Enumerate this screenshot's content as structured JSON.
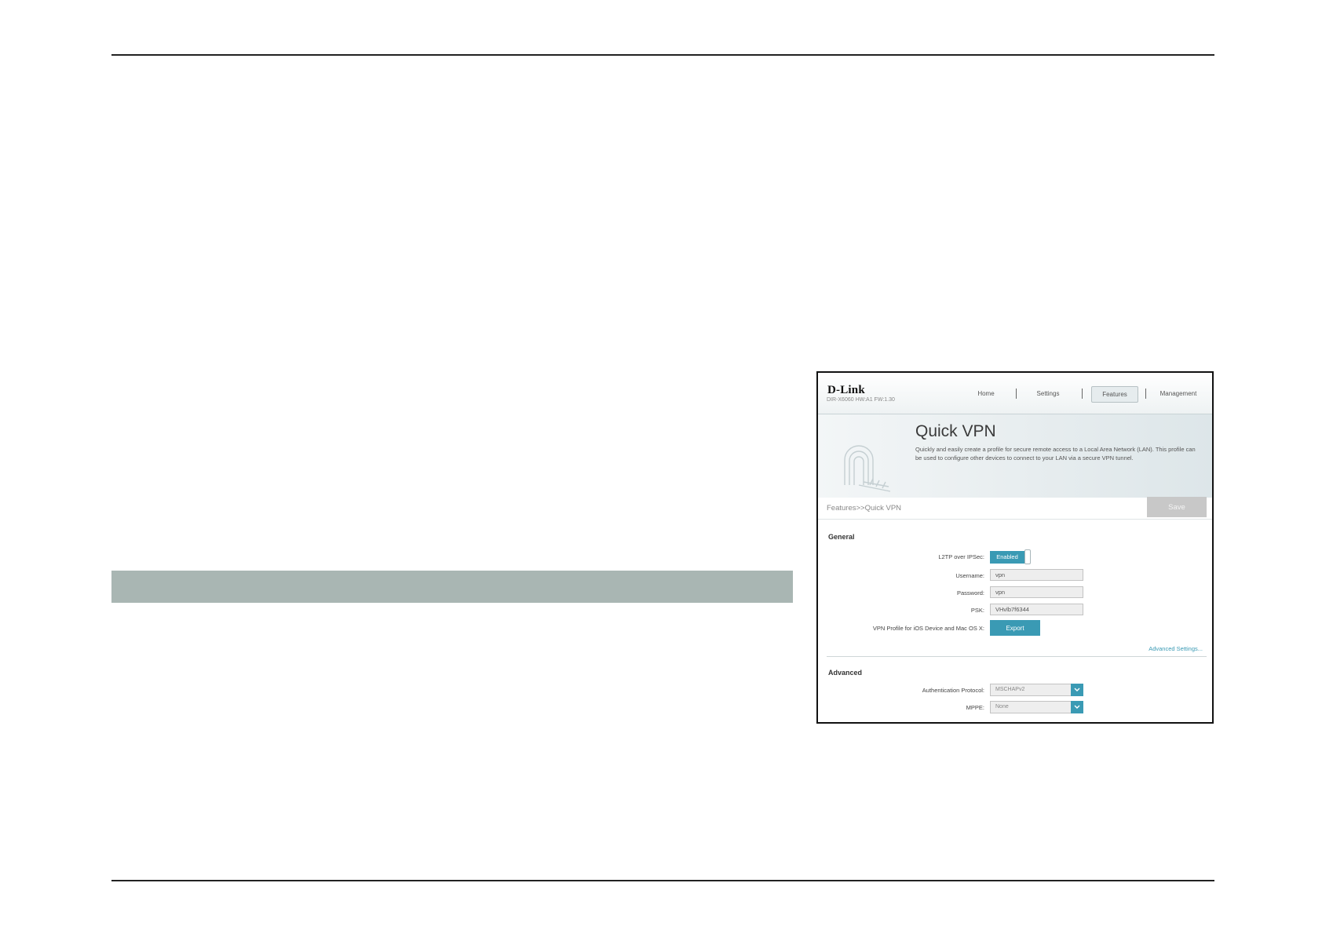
{
  "header": {
    "logo": "D-Link",
    "model": "DIR-X6060 HW:A1 FW:1.30",
    "nav": [
      "Home",
      "Settings",
      "Features",
      "Management"
    ],
    "active_nav": "Features"
  },
  "banner": {
    "title": "Quick VPN",
    "description": "Quickly and easily create a profile for secure remote access to a Local Area Network (LAN). This profile can be used to configure other devices to connect to your LAN via a secure VPN tunnel."
  },
  "breadcrumb": "Features>>Quick VPN",
  "toolbar": {
    "save_label": "Save"
  },
  "general": {
    "heading": "General",
    "l2tp_label": "L2TP over IPSec:",
    "l2tp_state": "Enabled",
    "username_label": "Username:",
    "username_value": "vpn",
    "password_label": "Password:",
    "password_value": "vpn",
    "psk_label": "PSK:",
    "psk_value": "VHvlb7f6344",
    "profile_label": "VPN Profile for iOS Device and Mac OS X:",
    "export_label": "Export",
    "advanced_link": "Advanced Settings..."
  },
  "advanced": {
    "heading": "Advanced",
    "auth_label": "Authentication Protocol:",
    "auth_value": "MSCHAPv2",
    "mppe_label": "MPPE:",
    "mppe_value": "None"
  },
  "colors": {
    "accent": "#3a9ab4",
    "band": "#a9b6b3",
    "save_disabled": "#c8c8c8"
  }
}
